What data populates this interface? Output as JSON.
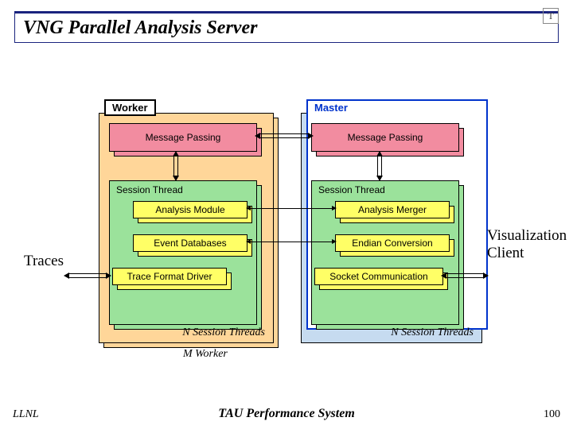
{
  "title": "VNG Parallel Analysis Server",
  "logo_letter": "T",
  "panels": {
    "worker_label": "Worker",
    "master_label": "Master"
  },
  "boxes": {
    "message_passing": "Message Passing",
    "session_thread": "Session Thread",
    "analysis_module": "Analysis Module",
    "event_databases": "Event Databases",
    "trace_format_driver": "Trace Format Driver",
    "analysis_merger": "Analysis Merger",
    "endian_conversion": "Endian Conversion",
    "socket_communication": "Socket Communication"
  },
  "sub": {
    "n_session_threads": "N Session Threads",
    "m_worker": "M Worker"
  },
  "side": {
    "traces": "Traces",
    "viz": "Visualization\nClient"
  },
  "footer": {
    "left": "LLNL",
    "center": "TAU Performance System",
    "right": "100"
  }
}
